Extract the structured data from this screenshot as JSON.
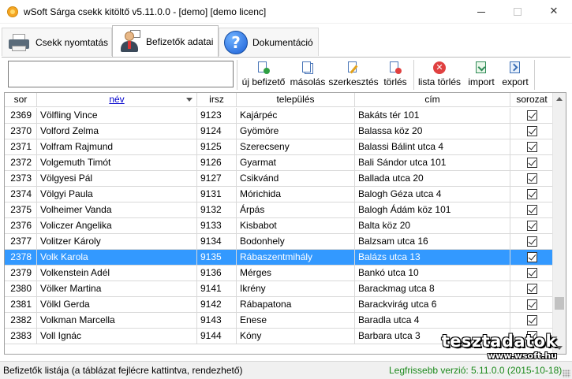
{
  "window": {
    "title": "wSoft Sárga csekk kitöltő v5.11.0.0 - [demo] [demo licenc]",
    "minimize": "—",
    "maximize": "",
    "close": "✕"
  },
  "tabs": [
    {
      "label": "Csekk nyomtatás",
      "icon": "printer-icon"
    },
    {
      "label": "Befizetők adatai",
      "icon": "person-icon",
      "active": true
    },
    {
      "label": "Dokumentáció",
      "icon": "help-icon",
      "glyph": "?"
    }
  ],
  "toolbar": {
    "search_value": "",
    "new_label": "új befizető",
    "copy_label": "másolás",
    "edit_label": "szerkesztés",
    "delete_label": "törlés",
    "clear_list_label": "lista törlés",
    "import_label": "import",
    "export_label": "export",
    "clear_glyph": "✕"
  },
  "table": {
    "headers": {
      "sor": "sor",
      "nev": "név",
      "irsz": "irsz",
      "telepules": "település",
      "cim": "cím",
      "sorozat": "sorozat"
    },
    "sorted_column": "nev",
    "scroll_position": 0.86,
    "rows": [
      {
        "sor": "2369",
        "nev": "Völfling Vince",
        "irsz": "9123",
        "telepules": "Kajárpéc",
        "cim": "Bakáts tér 101",
        "sorozat": true
      },
      {
        "sor": "2370",
        "nev": "Volford Zelma",
        "irsz": "9124",
        "telepules": "Gyömöre",
        "cim": "Balassa köz 20",
        "sorozat": true
      },
      {
        "sor": "2371",
        "nev": "Volfram Rajmund",
        "irsz": "9125",
        "telepules": "Szerecseny",
        "cim": "Balassi Bálint utca 4",
        "sorozat": true
      },
      {
        "sor": "2372",
        "nev": "Volgemuth Timót",
        "irsz": "9126",
        "telepules": "Gyarmat",
        "cim": "Bali Sándor utca 101",
        "sorozat": true
      },
      {
        "sor": "2373",
        "nev": "Völgyesi Pál",
        "irsz": "9127",
        "telepules": "Csikvánd",
        "cim": "Ballada utca 20",
        "sorozat": true
      },
      {
        "sor": "2374",
        "nev": "Völgyi Paula",
        "irsz": "9131",
        "telepules": "Mórichida",
        "cim": "Balogh Géza utca 4",
        "sorozat": true
      },
      {
        "sor": "2375",
        "nev": "Volheimer Vanda",
        "irsz": "9132",
        "telepules": "Árpás",
        "cim": "Balogh Ádám köz 101",
        "sorozat": true
      },
      {
        "sor": "2376",
        "nev": "Voliczer Angelika",
        "irsz": "9133",
        "telepules": "Kisbabot",
        "cim": "Balta köz 20",
        "sorozat": true
      },
      {
        "sor": "2377",
        "nev": "Volitzer Károly",
        "irsz": "9134",
        "telepules": "Bodonhely",
        "cim": "Balzsam utca 16",
        "sorozat": true
      },
      {
        "sor": "2378",
        "nev": "Volk Karola",
        "irsz": "9135",
        "telepules": "Rábaszentmihály",
        "cim": "Balázs utca 13",
        "sorozat": true,
        "selected": true
      },
      {
        "sor": "2379",
        "nev": "Volkenstein Adél",
        "irsz": "9136",
        "telepules": "Mérges",
        "cim": "Bankó utca 10",
        "sorozat": true
      },
      {
        "sor": "2380",
        "nev": "Völker Martina",
        "irsz": "9141",
        "telepules": "Ikrény",
        "cim": "Barackmag utca 8",
        "sorozat": true
      },
      {
        "sor": "2381",
        "nev": "Völkl Gerda",
        "irsz": "9142",
        "telepules": "Rábapatona",
        "cim": "Barackvirág utca 6",
        "sorozat": true
      },
      {
        "sor": "2382",
        "nev": "Volkman Marcella",
        "irsz": "9143",
        "telepules": "Enese",
        "cim": "Baradla utca 4",
        "sorozat": true
      },
      {
        "sor": "2383",
        "nev": "Voll Ignác",
        "irsz": "9144",
        "telepules": "Kóny",
        "cim": "Barbara utca 3",
        "sorozat": true
      }
    ]
  },
  "watermark": {
    "big": "tesztadatok",
    "small": "www.wsoft.hu"
  },
  "status": {
    "left": "Befizetők listája (a táblázat fejlécre kattintva, rendezhető)",
    "right": "Legfrissebb verzió: 5.11.0.0 (2015-10-18)"
  },
  "colors": {
    "selection": "#3399ff",
    "status_green": "#1b8a1b",
    "sorted_header": "#0000cc"
  }
}
